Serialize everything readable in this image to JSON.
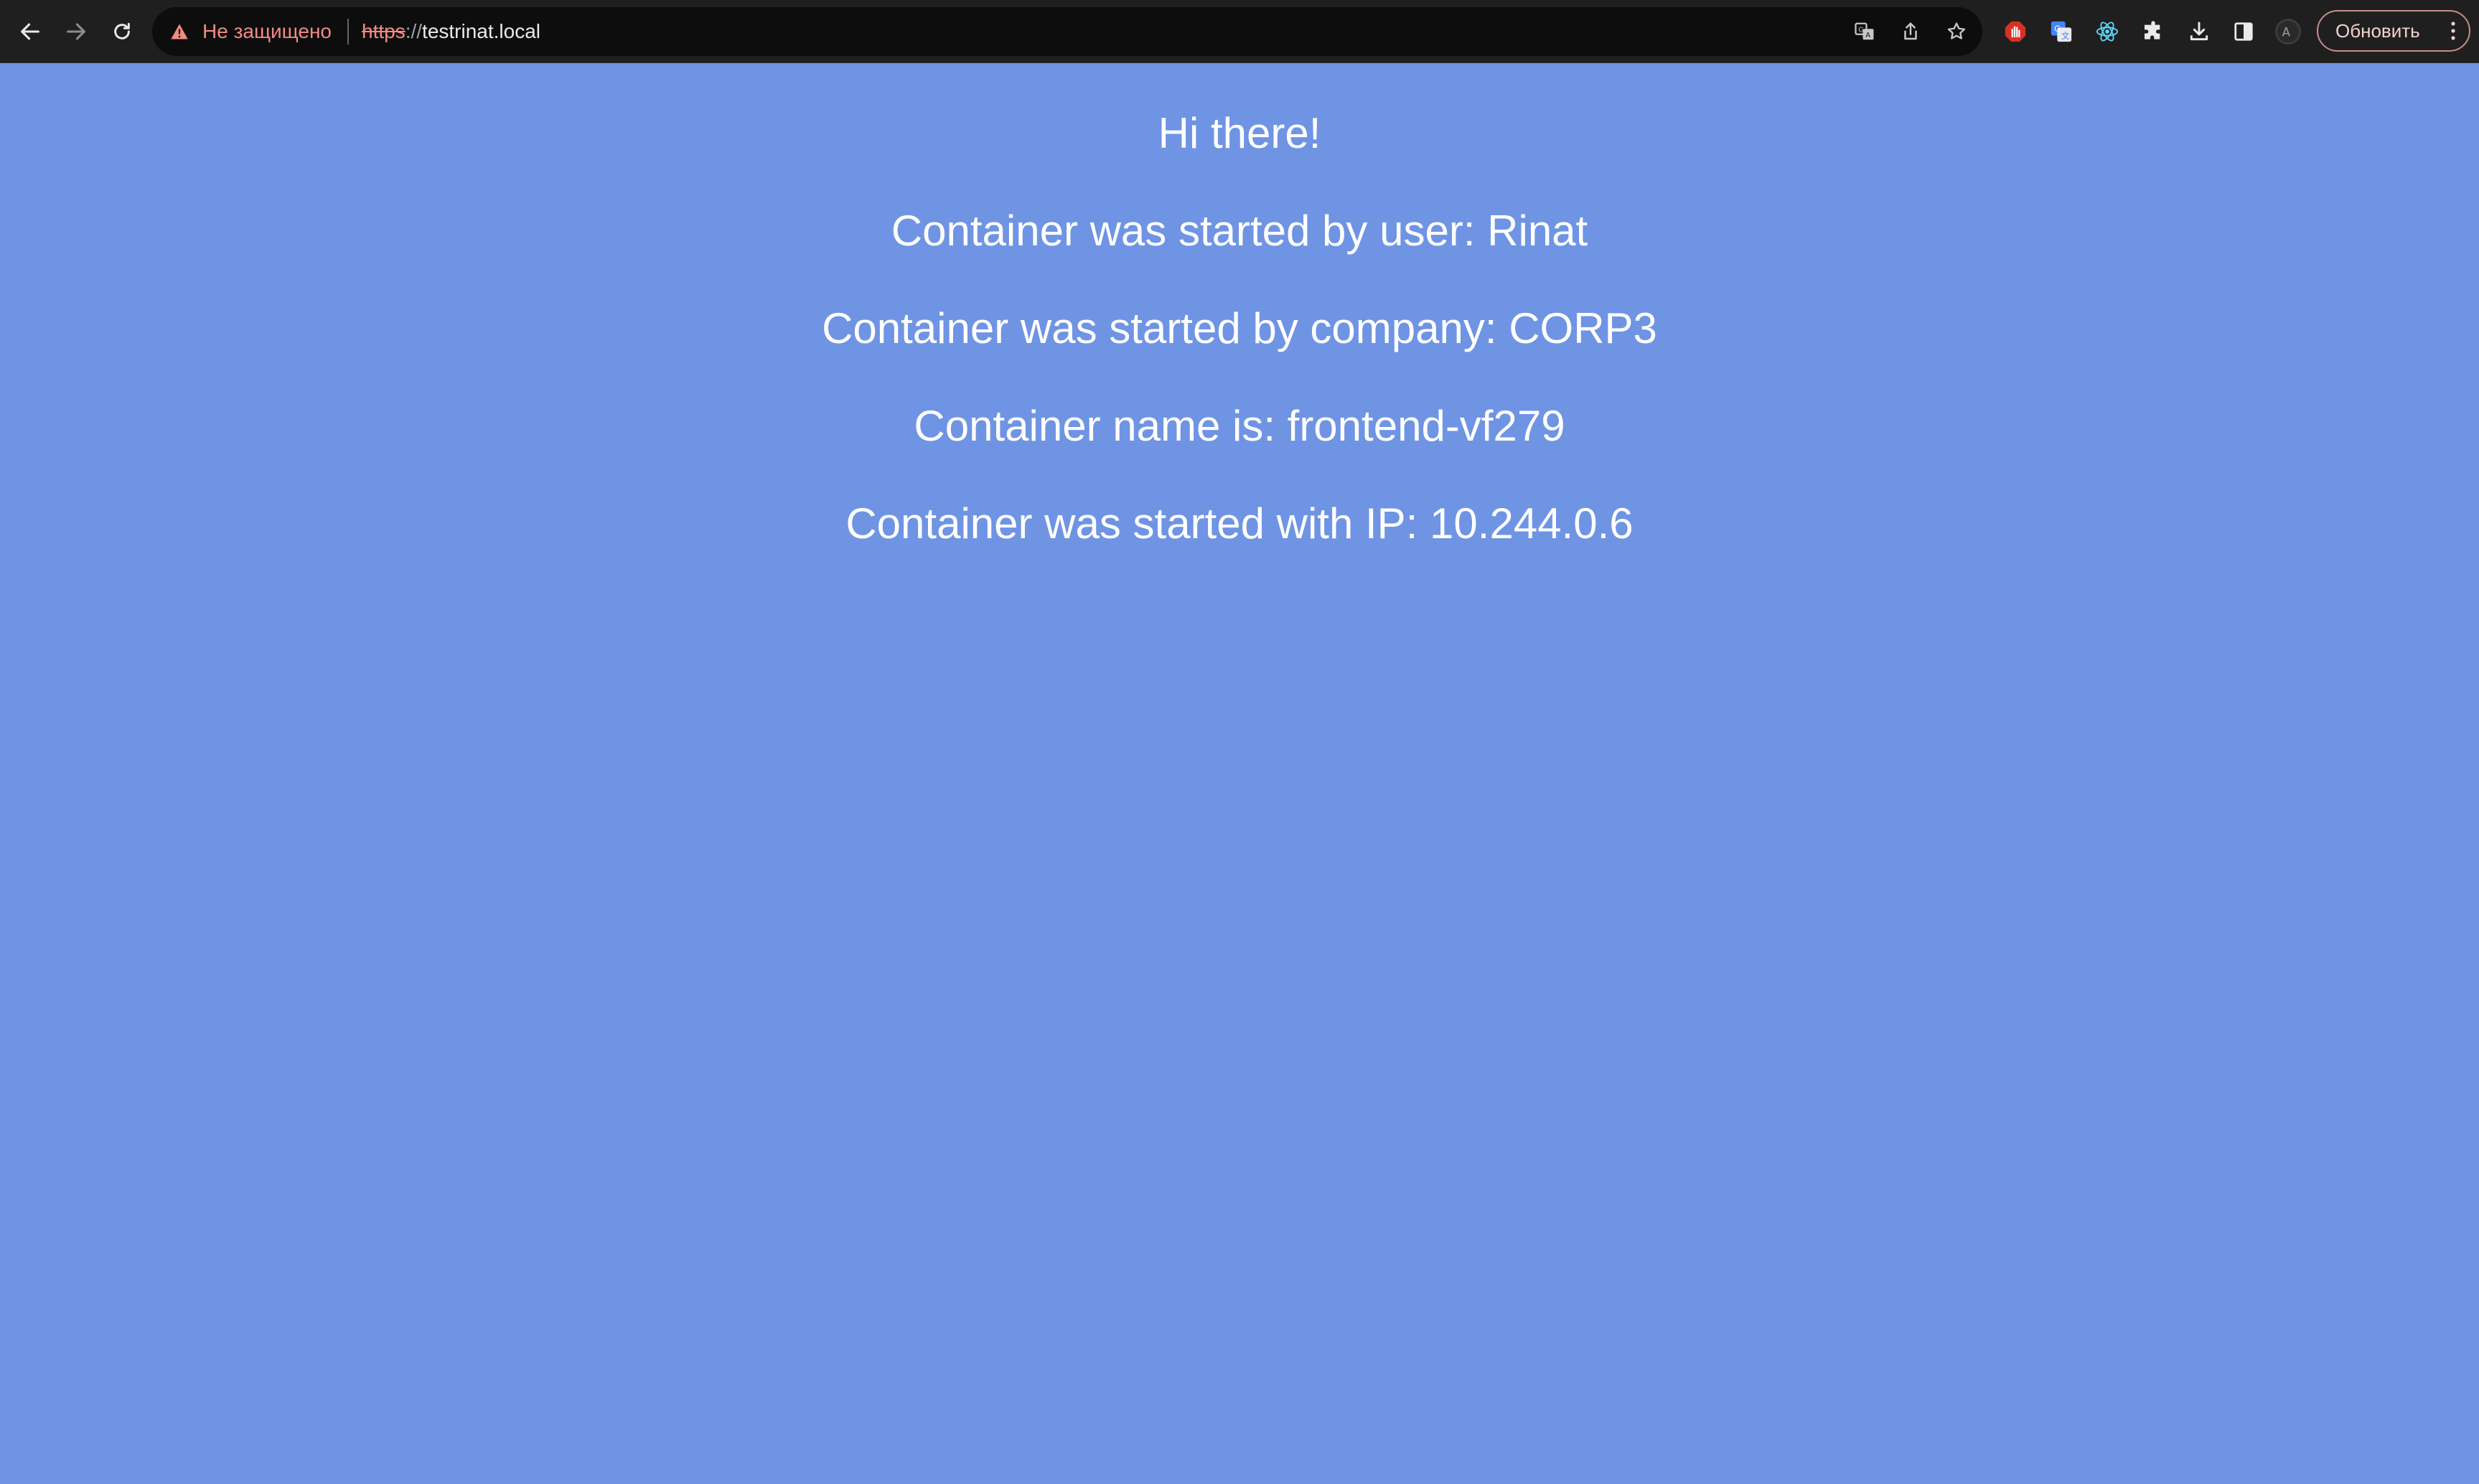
{
  "browser": {
    "security_status": "Не защищено",
    "url_scheme": "https",
    "url_slashes": "://",
    "url_host": "testrinat.local",
    "update_button_label": "Обновить",
    "icons": {
      "back": "arrow-left-icon",
      "forward": "arrow-right-icon",
      "reload": "reload-icon",
      "warning": "warning-triangle-icon",
      "translate": "translate-icon",
      "share": "share-icon",
      "bookmark": "star-icon",
      "extension_red": "stop-hand-icon",
      "extension_translate": "google-translate-icon",
      "extension_react": "react-icon",
      "extensions": "puzzle-icon",
      "downloads": "download-icon",
      "side_panel": "side-panel-icon",
      "profile": "profile-avatar-icon",
      "menu": "kebab-menu-icon"
    },
    "colors": {
      "toolbar": "#1f1f1f",
      "omnibox": "#0d0d0d",
      "insecure": "#f28b82"
    }
  },
  "page": {
    "background": "#6f94e4",
    "greeting": "Hi there!",
    "user_line": "Container was started by user: Rinat",
    "company_line": "Container was started by company: CORP3",
    "name_line": "Container name is: frontend-vf279",
    "ip_line": "Container was started with IP: 10.244.0.6"
  }
}
